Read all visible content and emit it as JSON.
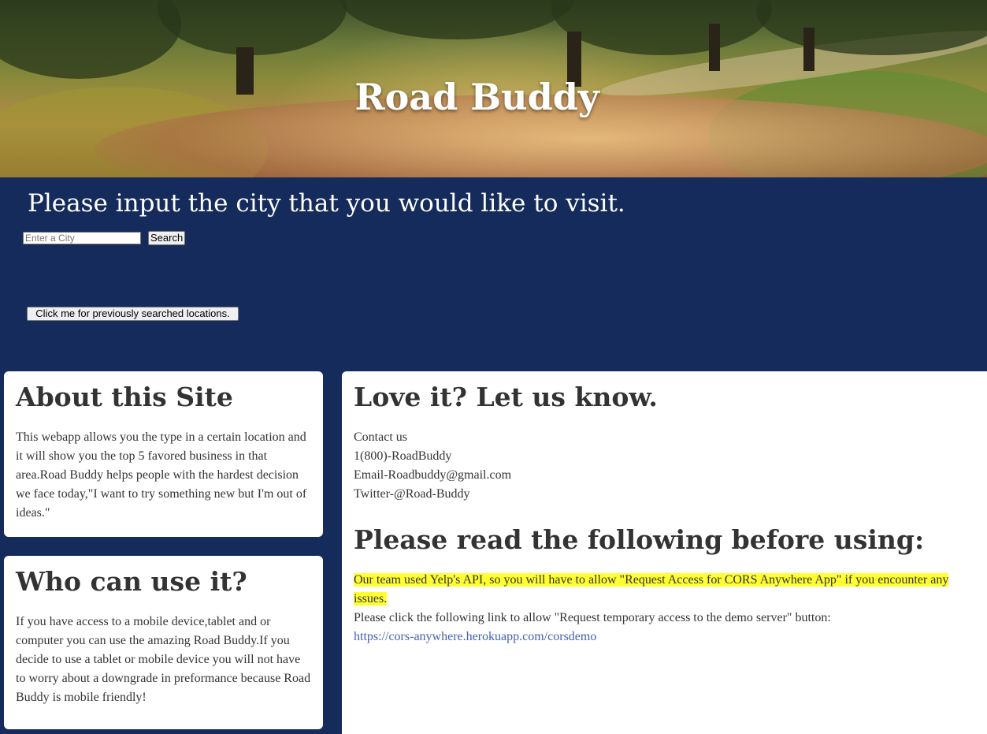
{
  "header": {
    "title": "Road Buddy"
  },
  "search": {
    "prompt": "Please input the city that you would like to visit.",
    "placeholder": "Enter a City",
    "button_label": "Search",
    "history_button_label": "Click me for previously searched locations."
  },
  "about": {
    "title": "About this Site",
    "body": "This webapp allows you the type in a certain location and it will show you the top 5 favored business in that area.Road Buddy helps people with the hardest decision we face today,\"I want to try something new but I'm out of ideas.\""
  },
  "who": {
    "title": "Who can use it?",
    "body": "If you have access to a mobile device,tablet and or computer you can use the amazing Road Buddy.If you decide to use a tablet or mobile device you will not have to worry about a downgrade in preformance because Road Buddy is mobile friendly!"
  },
  "contact": {
    "title": "Love it? Let us know.",
    "lines": [
      "Contact us",
      "1(800)-RoadBuddy",
      "Email-Roadbuddy@gmail.com",
      "Twitter-@Road-Buddy"
    ]
  },
  "notice": {
    "title": "Please read the following before using:",
    "highlight": "Our team used Yelp's API, so you will have to allow \"Request Access for CORS Anywhere App\" if you encounter any issues.",
    "instruction": "Please click the following link to allow \"Request temporary access to the demo server\" button:",
    "link": "https://cors-anywhere.herokuapp.com/corsdemo"
  },
  "colors": {
    "banner_bg": "#152b5c",
    "highlight": "#ffff33",
    "link": "#3f5fb8"
  }
}
